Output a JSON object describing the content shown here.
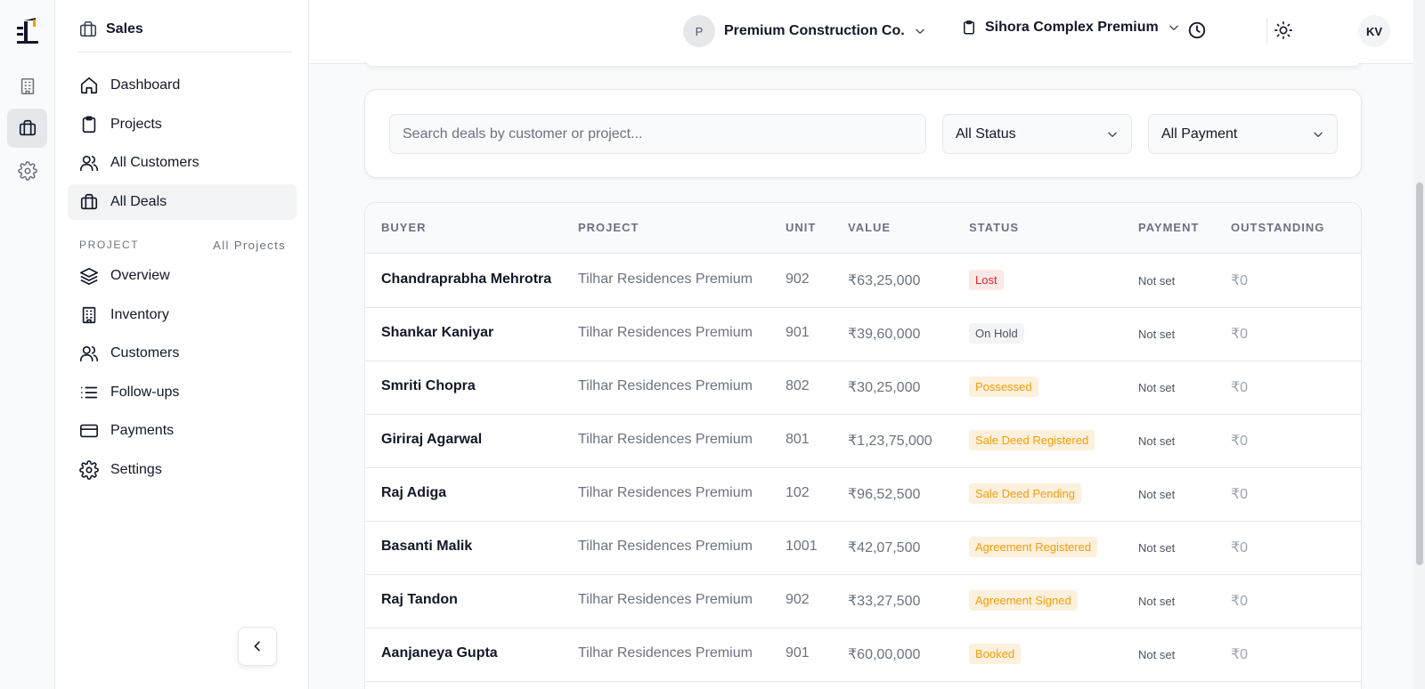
{
  "sidebar": {
    "section_title": "Sales",
    "nav": [
      {
        "label": "Dashboard",
        "icon": "home-icon"
      },
      {
        "label": "Projects",
        "icon": "clipboard-icon"
      },
      {
        "label": "All Customers",
        "icon": "users-icon"
      },
      {
        "label": "All Deals",
        "icon": "briefcase-icon",
        "active": true
      }
    ],
    "project_label": "PROJECT",
    "project_scope": "All Projects",
    "project_nav": [
      {
        "label": "Overview",
        "icon": "layers-icon"
      },
      {
        "label": "Inventory",
        "icon": "building-icon"
      },
      {
        "label": "Customers",
        "icon": "users-icon"
      },
      {
        "label": "Follow-ups",
        "icon": "list-icon"
      },
      {
        "label": "Payments",
        "icon": "credit-card-icon"
      },
      {
        "label": "Settings",
        "icon": "gear-icon"
      }
    ]
  },
  "topbar": {
    "org_initial": "P",
    "org_name": "Premium Construction Co.",
    "project_name": "Sihora Complex Premium",
    "user_initials": "KV"
  },
  "filters": {
    "search_placeholder": "Search deals by customer or project...",
    "status_value": "All Status",
    "payment_value": "All Payment"
  },
  "table": {
    "columns": [
      "BUYER",
      "PROJECT",
      "UNIT",
      "VALUE",
      "STATUS",
      "PAYMENT",
      "OUTSTANDING"
    ],
    "rows": [
      {
        "buyer": "Chandraprabha Mehrotra",
        "project": "Tilhar Residences Premium",
        "unit": "902",
        "value": "₹63,25,000",
        "status": "Lost",
        "payment": "Not set",
        "outstanding": "₹0"
      },
      {
        "buyer": "Shankar Kaniyar",
        "project": "Tilhar Residences Premium",
        "unit": "901",
        "value": "₹39,60,000",
        "status": "On Hold",
        "payment": "Not set",
        "outstanding": "₹0"
      },
      {
        "buyer": "Smriti Chopra",
        "project": "Tilhar Residences Premium",
        "unit": "802",
        "value": "₹30,25,000",
        "status": "Possessed",
        "payment": "Not set",
        "outstanding": "₹0"
      },
      {
        "buyer": "Giriraj Agarwal",
        "project": "Tilhar Residences Premium",
        "unit": "801",
        "value": "₹1,23,75,000",
        "status": "Sale Deed Registered",
        "payment": "Not set",
        "outstanding": "₹0"
      },
      {
        "buyer": "Raj Adiga",
        "project": "Tilhar Residences Premium",
        "unit": "102",
        "value": "₹96,52,500",
        "status": "Sale Deed Pending",
        "payment": "Not set",
        "outstanding": "₹0"
      },
      {
        "buyer": "Basanti Malik",
        "project": "Tilhar Residences Premium",
        "unit": "1001",
        "value": "₹42,07,500",
        "status": "Agreement Registered",
        "payment": "Not set",
        "outstanding": "₹0"
      },
      {
        "buyer": "Raj Tandon",
        "project": "Tilhar Residences Premium",
        "unit": "902",
        "value": "₹33,27,500",
        "status": "Agreement Signed",
        "payment": "Not set",
        "outstanding": "₹0"
      },
      {
        "buyer": "Aanjaneya Gupta",
        "project": "Tilhar Residences Premium",
        "unit": "901",
        "value": "₹60,00,000",
        "status": "Booked",
        "payment": "Not set",
        "outstanding": "₹0"
      }
    ]
  },
  "colors": {
    "lost": "#dc2626",
    "hold": "#4b5563",
    "progress": "#f59e0b"
  }
}
